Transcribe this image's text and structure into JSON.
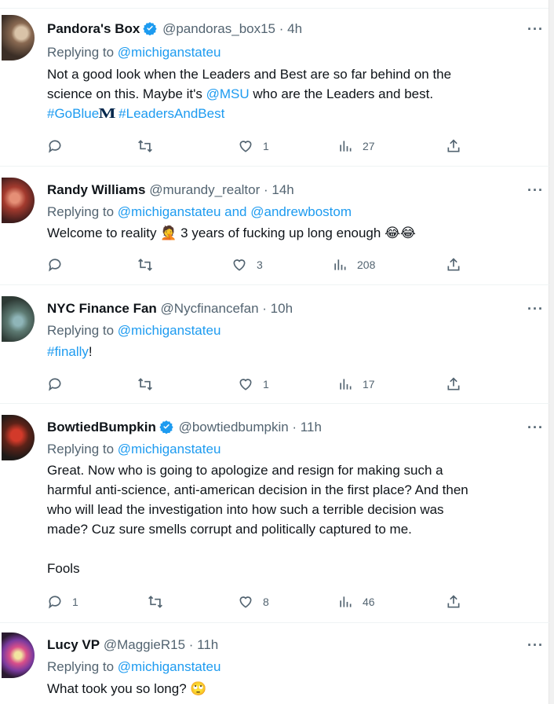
{
  "tweets": [
    {
      "name": "Pandora's Box",
      "verified": true,
      "handle": "@pandoras_box15",
      "time": "· 4h",
      "reply_prefix": "Replying to",
      "reply_to": "@michiganstateu",
      "reply_to_2": "",
      "body_line1": "Not a good look when the Leaders and Best are so far behind on the",
      "body_line2_pre": "science on this. Maybe it's",
      "body_mention": "@MSU",
      "body_line2_post": "who are the Leaders and best.",
      "hashtag1": "#GoBlue",
      "logo_letter": "M",
      "hashtag2": "#LeadersAndBest",
      "replies": "",
      "retweets": "",
      "likes": "1",
      "views": "27"
    },
    {
      "name": "Randy Williams",
      "verified": false,
      "handle": "@murandy_realtor",
      "time": "· 14h",
      "reply_prefix": "Replying to",
      "reply_to": "@michiganstateu",
      "reply_and": "and",
      "reply_to_2": "@andrewbostom",
      "body_pre": "Welcome to reality",
      "body_emoji1": "🤦",
      "body_post": "3 years of fucking up long enough",
      "body_emoji2": "😂😂",
      "replies": "",
      "retweets": "",
      "likes": "3",
      "views": "208"
    },
    {
      "name": "NYC Finance Fan",
      "verified": false,
      "handle": "@Nycfinancefan",
      "time": "· 10h",
      "reply_prefix": "Replying to",
      "reply_to": "@michiganstateu",
      "body_hashtag": "#finally",
      "body_post": "!",
      "replies": "",
      "retweets": "",
      "likes": "1",
      "views": "17"
    },
    {
      "name": "BowtiedBumpkin",
      "verified": true,
      "handle": "@bowtiedbumpkin",
      "time": "· 11h",
      "reply_prefix": "Replying to",
      "reply_to": "@michiganstateu",
      "body_lines": [
        "Great. Now who is going to apologize and resign for making such a",
        "harmful anti-science, anti-american decision in the first place?  And then",
        "who will lead the investigation into how such a terrible decision was",
        "made? Cuz sure smells corrupt and politically captured to me."
      ],
      "body_last": "Fools",
      "replies": "1",
      "retweets": "",
      "likes": "8",
      "views": "46"
    },
    {
      "name": "Lucy VP",
      "verified": false,
      "handle": "@MaggieR15",
      "time": "· 11h",
      "reply_prefix": "Replying to",
      "reply_to": "@michiganstateu",
      "body_text": "What took you so long?",
      "body_emoji": "🙄"
    }
  ],
  "more_label": "···",
  "colors": {
    "link": "#1d9bf0",
    "secondary": "#536471",
    "text": "#0f1419",
    "verified": "#1d9bf0"
  },
  "icons": [
    "reply-icon",
    "retweet-icon",
    "like-icon",
    "views-icon",
    "share-icon",
    "more-icon",
    "verified-icon"
  ]
}
